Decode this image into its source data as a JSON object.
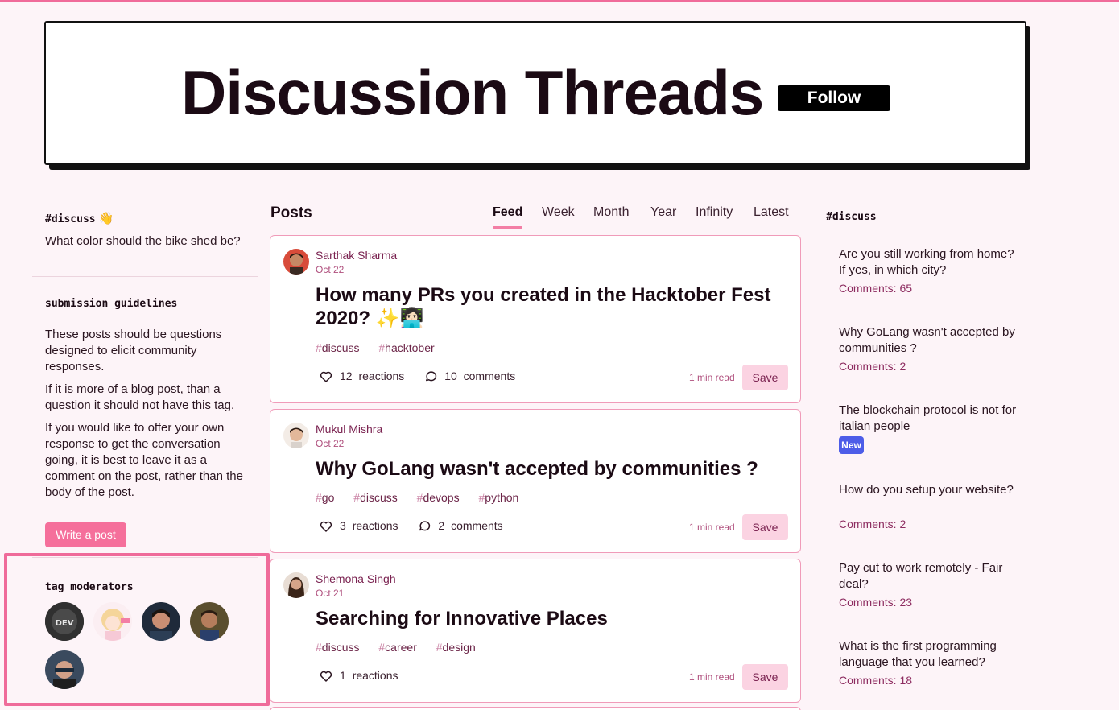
{
  "header": {
    "title": "Discussion Threads",
    "follow_label": "Follow"
  },
  "left": {
    "tag": "#discuss",
    "tag_emoji": "👋",
    "description": "What color should the bike shed be?",
    "guidelines_title": "submission guidelines",
    "guidelines": [
      "These posts should be questions designed to elicit community responses.",
      "If it is more of a blog post, than a question it should not have this tag.",
      "If you would like to offer your own response to get the conversation going, it is best to leave it as a comment on the post, rather than the body of the post."
    ],
    "write_label": "Write a post",
    "moderators_title": "tag moderators"
  },
  "posts": {
    "title": "Posts",
    "tabs": [
      "Feed",
      "Week",
      "Month",
      "Year",
      "Infinity",
      "Latest"
    ],
    "active_tab": "Feed",
    "items": [
      {
        "author": "Sarthak Sharma",
        "date": "Oct 22",
        "title": "How many PRs you created in the Hacktober Fest 2020? ✨👩🏻‍💻",
        "tags": [
          "discuss",
          "hacktober"
        ],
        "reactions": "12",
        "reactions_label": "reactions",
        "comments": "10",
        "comments_label": "comments",
        "read_time": "1 min read",
        "save_label": "Save"
      },
      {
        "author": "Mukul Mishra",
        "date": "Oct 22",
        "title": "Why GoLang wasn't accepted by communities ?",
        "tags": [
          "go",
          "discuss",
          "devops",
          "python"
        ],
        "reactions": "3",
        "reactions_label": "reactions",
        "comments": "2",
        "comments_label": "comments",
        "read_time": "1 min read",
        "save_label": "Save"
      },
      {
        "author": "Shemona Singh",
        "date": "Oct 21",
        "title": "Searching for Innovative Places",
        "tags": [
          "discuss",
          "career",
          "design"
        ],
        "reactions": "1",
        "reactions_label": "reactions",
        "read_time": "1 min read",
        "save_label": "Save"
      }
    ]
  },
  "right": {
    "tag": "#discuss",
    "items": [
      {
        "question": "Are you still working from home? If yes, in which city?",
        "comments": "Comments: 65"
      },
      {
        "question": "Why GoLang wasn't accepted by communities ?",
        "comments": "Comments: 2"
      },
      {
        "question": "The blockchain protocol is not for italian people",
        "badge": "New"
      },
      {
        "question": "How do you setup your website?",
        "comments": "Comments: 2"
      },
      {
        "question": "Pay cut to work remotely - Fair deal?",
        "comments": "Comments: 23"
      },
      {
        "question": "What is the first programming language that you learned?",
        "comments": "Comments: 18"
      }
    ]
  },
  "icons": {
    "reactions": "heart-icon",
    "comments": "comment-bubble-icon"
  },
  "colors": {
    "accent": "#f56f9b",
    "background": "#fdf4f8",
    "badge_new": "#4d5de8",
    "highlight_border": "#ef6b9a"
  }
}
